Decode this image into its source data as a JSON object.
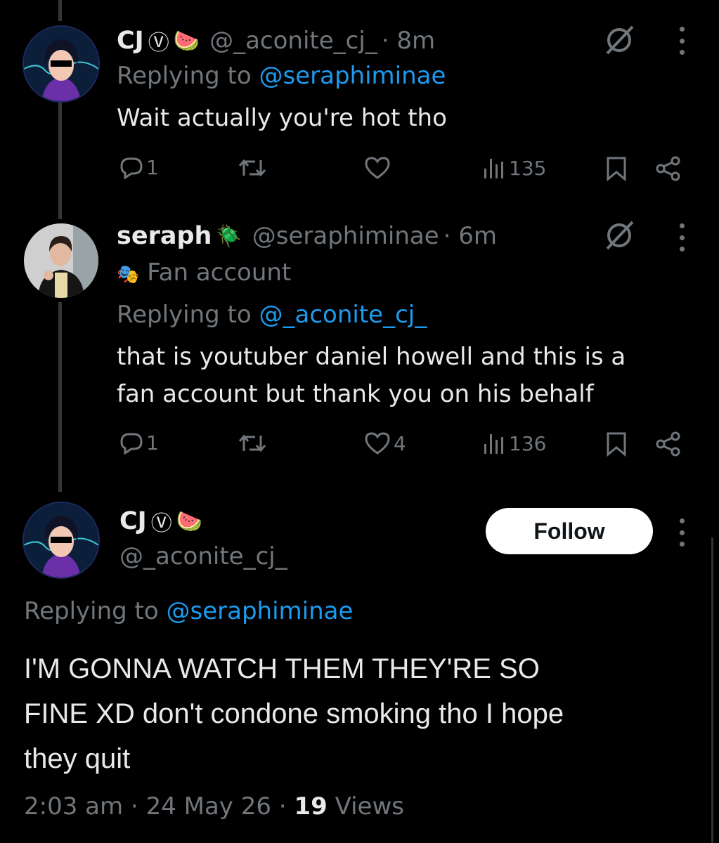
{
  "tweets": [
    {
      "display_name": "CJ",
      "badge": "Ⓥ",
      "emoji": "🍉",
      "handle": "@_aconite_cj_",
      "time": "· 8m",
      "replying_prefix": "Replying to",
      "replying_to": "@seraphiminae",
      "text": "Wait actually you're hot tho",
      "replies": "1",
      "retweets": "",
      "likes": "",
      "views": "135"
    },
    {
      "display_name": "seraph",
      "emoji": "🪲",
      "handle": "@seraphiminae",
      "time": "· 6m",
      "label_icon": "🎭",
      "label": "Fan account",
      "replying_prefix": "Replying to",
      "replying_to": "@_aconite_cj_",
      "text_line1": "that is youtuber daniel howell and this is a",
      "text_line2": "fan account but thank you on his behalf",
      "replies": "1",
      "retweets": "",
      "likes": "4",
      "views": "136"
    }
  ],
  "main": {
    "display_name": "CJ",
    "badge": "Ⓥ",
    "emoji": "🍉",
    "handle": "@_aconite_cj_",
    "follow_label": "Follow",
    "replying_prefix": "Replying to",
    "replying_to": "@seraphiminae",
    "text_line1": "I'M GONNA WATCH THEM THEY'RE SO",
    "text_line2": "FINE XD don't condone smoking tho I hope",
    "text_line3": "they quit",
    "time": "2:03 am",
    "date": "24 May 26",
    "views_count": "19",
    "views_label": "Views",
    "separator": " · "
  },
  "colors": {
    "background": "#000000",
    "text": "#e7e9ea",
    "muted": "#71767b",
    "link": "#1d9bf0",
    "follow_bg": "#ffffff"
  }
}
